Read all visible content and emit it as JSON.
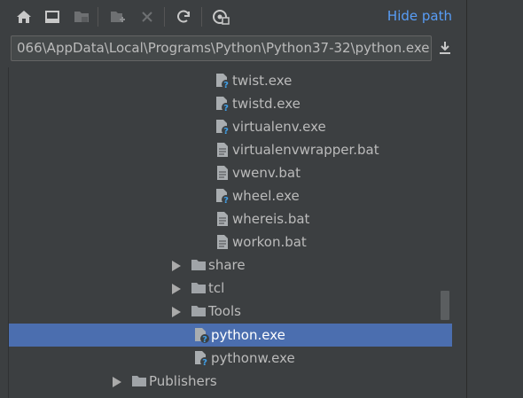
{
  "toolbar": {
    "hide_path_label": "Hide path"
  },
  "path": {
    "value": "066\\AppData\\Local\\Programs\\Python\\Python37-32\\python.exe"
  },
  "tree": {
    "items": [
      {
        "label": "twist.exe",
        "icon": "exe-file-icon"
      },
      {
        "label": "twistd.exe",
        "icon": "exe-file-icon"
      },
      {
        "label": "virtualenv.exe",
        "icon": "exe-file-icon"
      },
      {
        "label": "virtualenvwrapper.bat",
        "icon": "text-file-icon"
      },
      {
        "label": "vwenv.bat",
        "icon": "text-file-icon"
      },
      {
        "label": "wheel.exe",
        "icon": "exe-file-icon"
      },
      {
        "label": "whereis.bat",
        "icon": "text-file-icon"
      },
      {
        "label": "workon.bat",
        "icon": "text-file-icon"
      },
      {
        "label": "share",
        "icon": "folder-icon"
      },
      {
        "label": "tcl",
        "icon": "folder-icon"
      },
      {
        "label": "Tools",
        "icon": "folder-icon"
      },
      {
        "label": "python.exe",
        "icon": "exe-file-icon",
        "selected": true
      },
      {
        "label": "pythonw.exe",
        "icon": "exe-file-icon"
      },
      {
        "label": "Publishers",
        "icon": "folder-icon"
      }
    ]
  },
  "colors": {
    "selection": "#4b6eaf",
    "link": "#589df6",
    "background": "#3c3f41"
  }
}
